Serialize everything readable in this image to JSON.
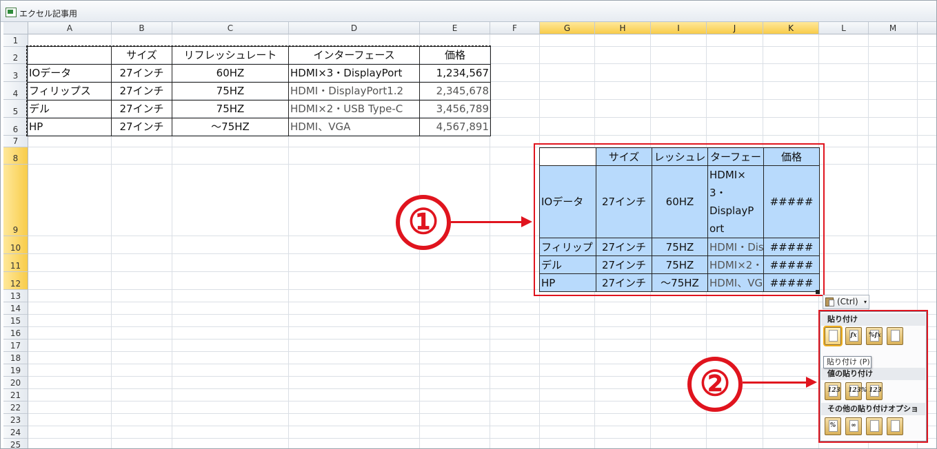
{
  "window": {
    "title": "エクセル記事用"
  },
  "columns": [
    "A",
    "B",
    "C",
    "D",
    "E",
    "F",
    "G",
    "H",
    "I",
    "J",
    "K",
    "L",
    "M"
  ],
  "selected_columns": [
    "G",
    "H",
    "I",
    "J",
    "K"
  ],
  "rows": [
    "1",
    "2",
    "3",
    "4",
    "5",
    "6",
    "7",
    "8",
    "9",
    "10",
    "11",
    "12",
    "13",
    "14",
    "15",
    "16",
    "17",
    "18",
    "19",
    "20",
    "21",
    "22",
    "23",
    "24",
    "25"
  ],
  "selected_rows": [
    "8",
    "9",
    "10",
    "11",
    "12"
  ],
  "source_table": {
    "headers": [
      "",
      "サイズ",
      "リフレッシュレート",
      "インターフェース",
      "価格"
    ],
    "rows": [
      [
        "IOデータ",
        "27インチ",
        "60HZ",
        "HDMI×3・DisplayPort",
        "1,234,567"
      ],
      [
        "フィリップス",
        "27インチ",
        "75HZ",
        "HDMI・DisplayPort1.2",
        "2,345,678"
      ],
      [
        "デル",
        "27インチ",
        "75HZ",
        "HDMI×2・USB Type-C",
        "3,456,789"
      ],
      [
        "HP",
        "27インチ",
        "～75HZ",
        "HDMI、VGA",
        "4,567,891"
      ]
    ]
  },
  "pasted_table": {
    "headers": [
      "",
      "サイズ",
      "レッシュレ",
      "ターフェー",
      "価格"
    ],
    "row1": [
      "IOデータ",
      "27インチ",
      "60HZ",
      "#####"
    ],
    "row1_interface_lines": [
      "HDMI×",
      "3・",
      "DisplayP",
      "ort"
    ],
    "rows": [
      [
        "フィリップ",
        "27インチ",
        "75HZ",
        "HDMI・Dis",
        "#####"
      ],
      [
        "デル",
        "27インチ",
        "75HZ",
        "HDMI×2・",
        "#####"
      ],
      [
        "HP",
        "27インチ",
        "～75HZ",
        "HDMI、VG",
        "#####"
      ]
    ]
  },
  "annotations": {
    "one": "①",
    "two": "②"
  },
  "paste_options": {
    "button_label": "(Ctrl)",
    "section_paste": "貼り付け",
    "section_values": "値の貼り付け",
    "section_other": "その他の貼り付けオプション",
    "tooltip": "貼り付け (P)",
    "paste_icons": [
      "",
      "fx",
      "%fx",
      ""
    ],
    "values_icons": [
      "123",
      "123%",
      "123"
    ],
    "other_icons": [
      "%",
      "∞",
      "",
      ""
    ]
  },
  "colors": {
    "accent_red": "#e0141e",
    "selection_blue": "#b8dafc",
    "header_selected": "#f8cc4a"
  }
}
